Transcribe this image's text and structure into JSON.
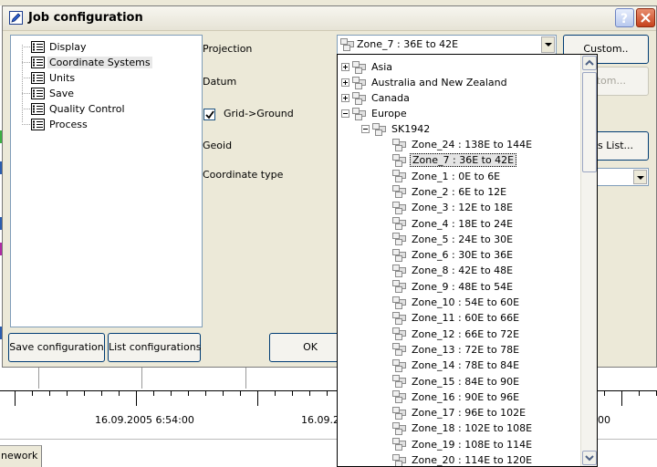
{
  "dialog": {
    "title": "Job configuration",
    "tree": [
      {
        "label": "Display",
        "selected": false
      },
      {
        "label": "Coordinate Systems",
        "selected": true
      },
      {
        "label": "Units",
        "selected": false
      },
      {
        "label": "Save",
        "selected": false
      },
      {
        "label": "Quality Control",
        "selected": false
      },
      {
        "label": "Process",
        "selected": false
      }
    ],
    "form": {
      "projection_label": "Projection",
      "projection_value": "Zone_7 : 36E to 42E",
      "datum_label": "Datum",
      "grid_ground_label": "Grid->Ground",
      "grid_ground_checked": true,
      "geoid_label": "Geoid",
      "coordinate_type_label": "Coordinate type"
    },
    "buttons": {
      "custom": "Custom..",
      "custom2_partial": "stom...",
      "list_partial": "ds List...",
      "save_configuration": "Save configuration",
      "list_configurations": "List configurations",
      "ok": "OK"
    }
  },
  "dropdown": {
    "regions": [
      "Asia",
      "Australia and New Zealand",
      "Canada",
      "Europe"
    ],
    "group": "SK1942",
    "zones": [
      "Zone_24 : 138E to 144E",
      "Zone_7 : 36E to 42E",
      "Zone_1 : 0E to 6E",
      "Zone_2 : 6E to 12E",
      "Zone_3 : 12E to 18E",
      "Zone_4 : 18E to 24E",
      "Zone_5 : 24E to 30E",
      "Zone_6 : 30E to 36E",
      "Zone_8 : 42E to 48E",
      "Zone_9 : 48E to 54E",
      "Zone_10 : 54E to 60E",
      "Zone_11 : 60E to 66E",
      "Zone_12 : 66E to 72E",
      "Zone_13 : 72E to 78E",
      "Zone_14 : 78E to 84E",
      "Zone_15 : 84E to 90E",
      "Zone_16 : 90E to 96E",
      "Zone_17 : 96E to 102E",
      "Zone_18 : 102E to 108E",
      "Zone_19 : 108E to 114E",
      "Zone_20 : 114E to 120E"
    ],
    "selected_zone": "Zone_7 : 36E to 42E"
  },
  "timeline": {
    "label_left": "16.09.2005 6:54:00",
    "label_mid_partial": "16.09.2",
    "label_right_partial": "00"
  },
  "bottom_tab": {
    "label_partial": "nework"
  },
  "colors": {
    "dialog_bg": "#ece9d8",
    "close_button": "#c6421d",
    "help_button": "#b7c8ee"
  }
}
